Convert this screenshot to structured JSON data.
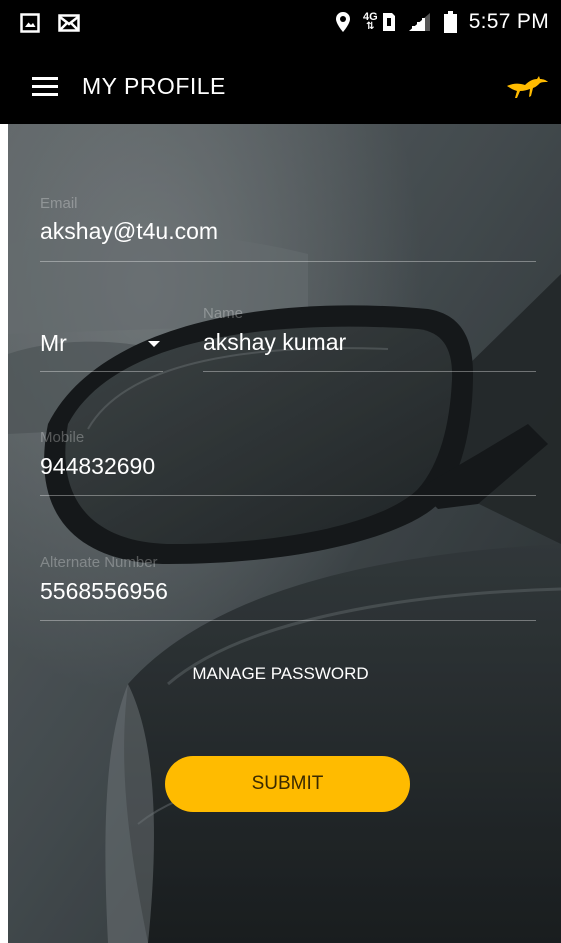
{
  "status_bar": {
    "network": "4G",
    "time": "5:57 PM",
    "icons": [
      "gallery-icon",
      "mail-icon",
      "location-icon",
      "network-icon",
      "signal-icon",
      "battery-icon"
    ]
  },
  "app_bar": {
    "title": "MY PROFILE",
    "menu_icon": "hamburger-menu-icon",
    "logo_icon": "kangaroo-logo-icon"
  },
  "form": {
    "email": {
      "label": "Email",
      "value": "akshay@t4u.com"
    },
    "salutation": {
      "value": "Mr",
      "options_visible": [
        "Mr"
      ]
    },
    "name": {
      "label": "Name",
      "value": "akshay kumar"
    },
    "mobile": {
      "label": "Mobile",
      "value": "944832690"
    },
    "alternate": {
      "label": "Alternate Number",
      "value": "5568556956"
    },
    "manage_password": "MANAGE PASSWORD",
    "submit": "SUBMIT"
  },
  "colors": {
    "accent": "#ffbb00",
    "app_bar": "#000000",
    "text": "#ffffff"
  }
}
